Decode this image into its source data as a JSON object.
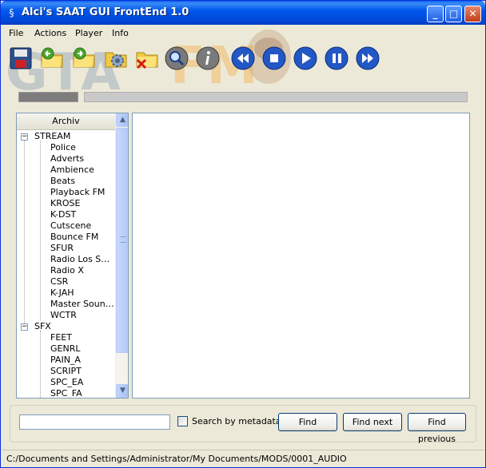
{
  "window": {
    "title": "Alci's SAAT GUI FrontEnd 1.0",
    "minimize": "_",
    "maximize": "□",
    "close": "✕"
  },
  "menu": {
    "items": [
      {
        "label": "File"
      },
      {
        "label": "Actions"
      },
      {
        "label": "Player"
      },
      {
        "label": "Info"
      }
    ]
  },
  "toolbar": {
    "icons": [
      "save-icon",
      "open-folder-back-icon",
      "open-folder-forward-icon",
      "settings-gear-icon",
      "delete-folder-icon",
      "search-icon",
      "info-icon",
      "rewind-icon",
      "stop-icon",
      "play-icon",
      "pause-icon",
      "fast-forward-icon"
    ]
  },
  "watermark": {
    "left": "GTA",
    "right": "FM"
  },
  "tree": {
    "header": "Archiv",
    "groups": [
      {
        "label": "STREAM",
        "expander": "−",
        "children": [
          "Police",
          "Adverts",
          "Ambience",
          "Beats",
          "Playback FM",
          "KROSE",
          "K-DST",
          "Cutscene",
          "Bounce FM",
          "SFUR",
          "Radio Los Sa...",
          "Radio X",
          "CSR",
          "K-JAH",
          "Master Sounds",
          "WCTR"
        ]
      },
      {
        "label": "SFX",
        "expander": "−",
        "children": [
          "FEET",
          "GENRL",
          "PAIN_A",
          "SCRIPT",
          "SPC_EA",
          "SPC_FA"
        ]
      }
    ]
  },
  "search": {
    "value": "",
    "checkbox_label": "Search by metadata",
    "checked": false,
    "find": "Find",
    "find_next": "Find next",
    "find_previous": "Find previous"
  },
  "status": {
    "path": "C:/Documents and Settings/Administrator/My Documents/MODS/0001_AUDIO"
  },
  "colors": {
    "titlebar": "#0058ee",
    "window_bg": "#ece9d8",
    "panel_border": "#7f9db9",
    "media_button": "#2257c6"
  }
}
